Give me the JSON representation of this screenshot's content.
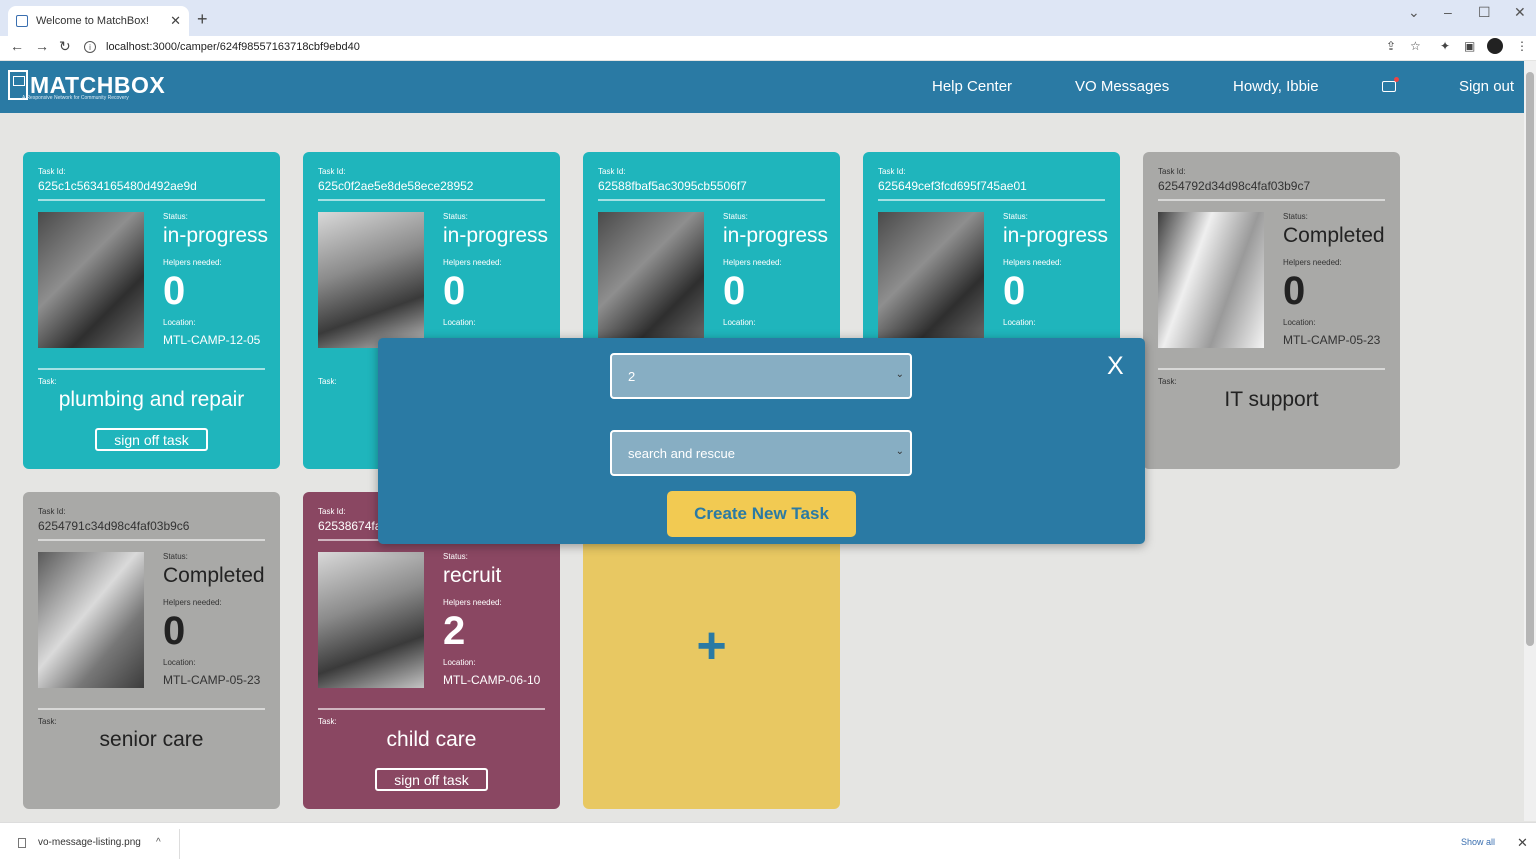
{
  "browser": {
    "tab_title": "Welcome to MatchBox!",
    "tab_close": "✕",
    "new_tab": "+",
    "url": "localhost:3000/camper/624f98557163718cbf9ebd40",
    "url_info": "i",
    "window_controls": [
      "⌄",
      "–",
      "☐",
      "✕"
    ],
    "nav": {
      "back": "←",
      "forward": "→",
      "reload": "↻"
    },
    "toolbar_icons": {
      "share": "⇪",
      "star": "☆",
      "extensions": "✦",
      "sidepanel": "▣",
      "menu": "⋮"
    }
  },
  "header": {
    "logo_text": "MATCHBOX",
    "logo_subtitle": "A Responsive Network for Community Recovery",
    "nav": [
      "Help Center",
      "VO Messages",
      "Howdy, Ibbie",
      "Sign out"
    ]
  },
  "labels": {
    "task_id": "Task Id:",
    "status": "Status:",
    "helpers": "Helpers needed:",
    "location": "Location:",
    "task": "Task:",
    "signoff": "sign off task"
  },
  "cards": [
    {
      "task_id": "625c1c5634165480d492ae9d",
      "status": "in-progress",
      "helpers": "0",
      "location": "MTL-CAMP-12-05",
      "task": "plumbing and repair"
    },
    {
      "task_id": "625c0f2ae5e8de58ece28952",
      "status": "in-progress",
      "helpers": "0",
      "location": "",
      "task": ""
    },
    {
      "task_id": "62588fbaf5ac3095cb5506f7",
      "status": "in-progress",
      "helpers": "0",
      "location": "",
      "task": ""
    },
    {
      "task_id": "625649cef3fcd695f745ae01",
      "status": "in-progress",
      "helpers": "0",
      "location": "",
      "task": ""
    },
    {
      "task_id": "6254792d34d98c4faf03b9c7",
      "status": "Completed",
      "helpers": "0",
      "location": "MTL-CAMP-05-23",
      "task": "IT support"
    },
    {
      "task_id": "6254791c34d98c4faf03b9c6",
      "status": "Completed",
      "helpers": "0",
      "location": "MTL-CAMP-05-23",
      "task": "senior care"
    },
    {
      "task_id": "62538674fa",
      "status": "recruit",
      "helpers": "2",
      "location": "MTL-CAMP-06-10",
      "task": "child care"
    }
  ],
  "add_card": {
    "icon": "+"
  },
  "modal": {
    "close": "X",
    "helpers_select": "2",
    "task_select": "search and rescue",
    "select_chevron": "⌄",
    "create_button": "Create New Task"
  },
  "download_bar": {
    "file": "vo-message-listing.png",
    "chevron": "^",
    "show_all": "Show all",
    "close": "✕"
  },
  "colors": {
    "header": "#2a7aa4",
    "teal_card": "#1fb5bc",
    "grey_card": "#a9a9a7",
    "plum_card": "#8a4762",
    "add_card": "#e8c862",
    "create_button": "#f2ca52"
  }
}
